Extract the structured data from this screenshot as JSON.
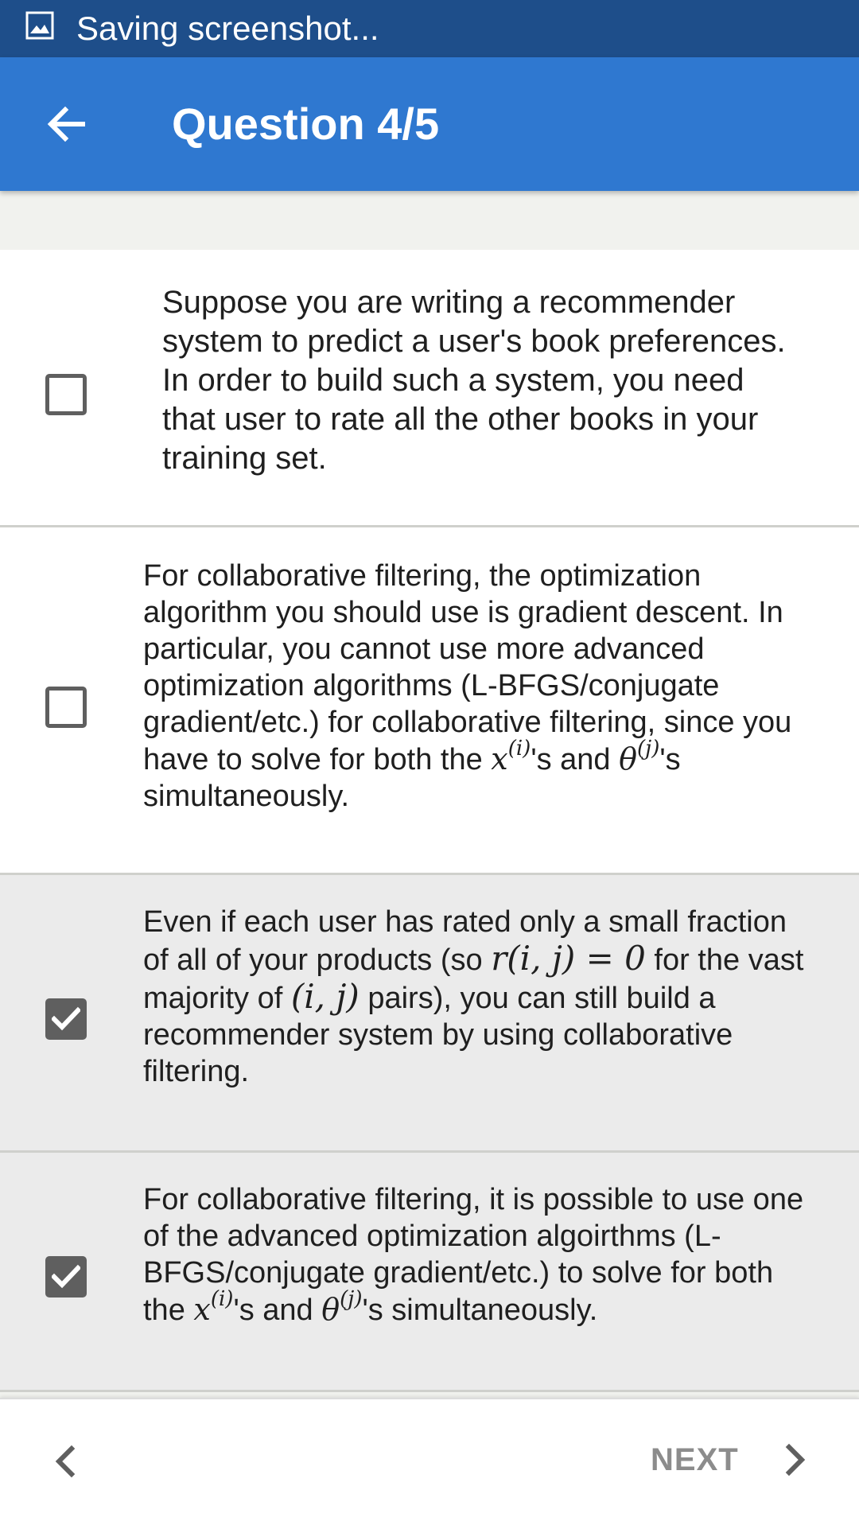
{
  "status_bar": {
    "text": "Saving screenshot...",
    "icon": "image-icon"
  },
  "app_bar": {
    "title": "Question 4/5",
    "back_icon": "arrow-left-icon"
  },
  "options": [
    {
      "checked": false,
      "text": "Suppose you are writing a recommender system to predict a user's book preferences. In order to build such a system, you need that user to rate all the other books in your training set."
    },
    {
      "checked": false,
      "text_before": "For collaborative filtering, the optimization algorithm you should use is gradient descent. In particular, you cannot use more advanced optimization algorithms (L-BFGS/conjugate gradient/etc.) for collaborative filtering, since you have to solve for both the ",
      "math_x": "x",
      "sup_i": "(i)",
      "mid": "'s and ",
      "math_theta": "θ",
      "sup_j": "(j)",
      "after": "'s simultaneously."
    },
    {
      "checked": true,
      "text_before": "Even if each user has rated only a small fraction of all of your products (so ",
      "math_r": "r(i, j) = 0",
      "mid": " for the vast majority of ",
      "math_ij": "(i, j)",
      "after": " pairs), you can still build a recommender system by using collaborative filtering."
    },
    {
      "checked": true,
      "text_before": "For collaborative filtering, it is possible to use one of the advanced optimization algoirthms (L-BFGS/conjugate gradient/etc.) to solve for both the ",
      "math_x": "x",
      "sup_i": "(i)",
      "mid": "'s and ",
      "math_theta": "θ",
      "sup_j": "(j)",
      "after": "'s simultaneously."
    }
  ],
  "bottom_nav": {
    "next_label": "NEXT",
    "prev_icon": "chevron-left-icon",
    "next_icon": "chevron-right-icon"
  },
  "colors": {
    "status_bar": "#1e4e8a",
    "app_bar": "#2f78d0",
    "selected_row": "#ebebeb",
    "checkbox": "#5f5f5f",
    "next_label": "#8c8c8c"
  }
}
